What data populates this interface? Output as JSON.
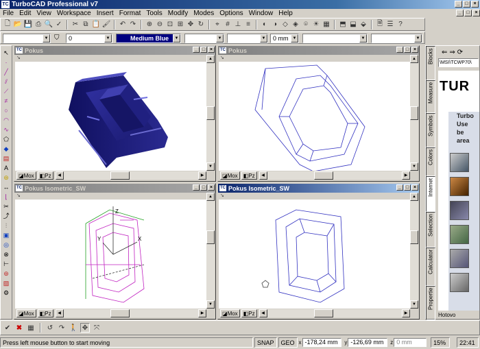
{
  "app": {
    "title": "TurboCAD Professional v7",
    "logo": "TC"
  },
  "menu": [
    "File",
    "Edit",
    "View",
    "Workspace",
    "Insert",
    "Format",
    "Tools",
    "Modify",
    "Modes",
    "Options",
    "Window",
    "Help"
  ],
  "toolbar2": {
    "layer_value": "0",
    "color_value": "Medium Blue",
    "color_hex": "#000080",
    "width_value": "0 mm"
  },
  "windows": [
    {
      "title": "Pokus",
      "active": false,
      "tabs": [
        "Mox",
        "Pz"
      ]
    },
    {
      "title": "Pokus",
      "active": false,
      "tabs": [
        "Mox",
        "Pz"
      ]
    },
    {
      "title": "Pokus Isometric_SW",
      "active": false,
      "tabs": [
        "Mox",
        "Pz"
      ]
    },
    {
      "title": "Pokus Isometric_SW",
      "active": true,
      "tabs": [
        "Mox",
        "Pz"
      ]
    }
  ],
  "axis_labels": {
    "z": "Z",
    "y": "Y",
    "x": "X"
  },
  "right_panel": {
    "url": "\\MSI\\TCWP70\\",
    "tabs": [
      "Blocks",
      "Measure",
      "Symbols",
      "Colors",
      "Internet",
      "Selection",
      "Calculator",
      "Propertie"
    ],
    "active_tab": "Internet",
    "web_logo": "TUR",
    "web_text": [
      "Turbo",
      "Use",
      "be",
      "area"
    ],
    "footer": "Hotovo"
  },
  "status": {
    "message": "Press left mouse button to start moving",
    "snap": "SNAP",
    "geo": "GEO",
    "x_value": "-178,24 mm",
    "y_value": "-126,69 mm",
    "z_value": "0 mm",
    "zoom": "15%",
    "time": "22:41"
  }
}
